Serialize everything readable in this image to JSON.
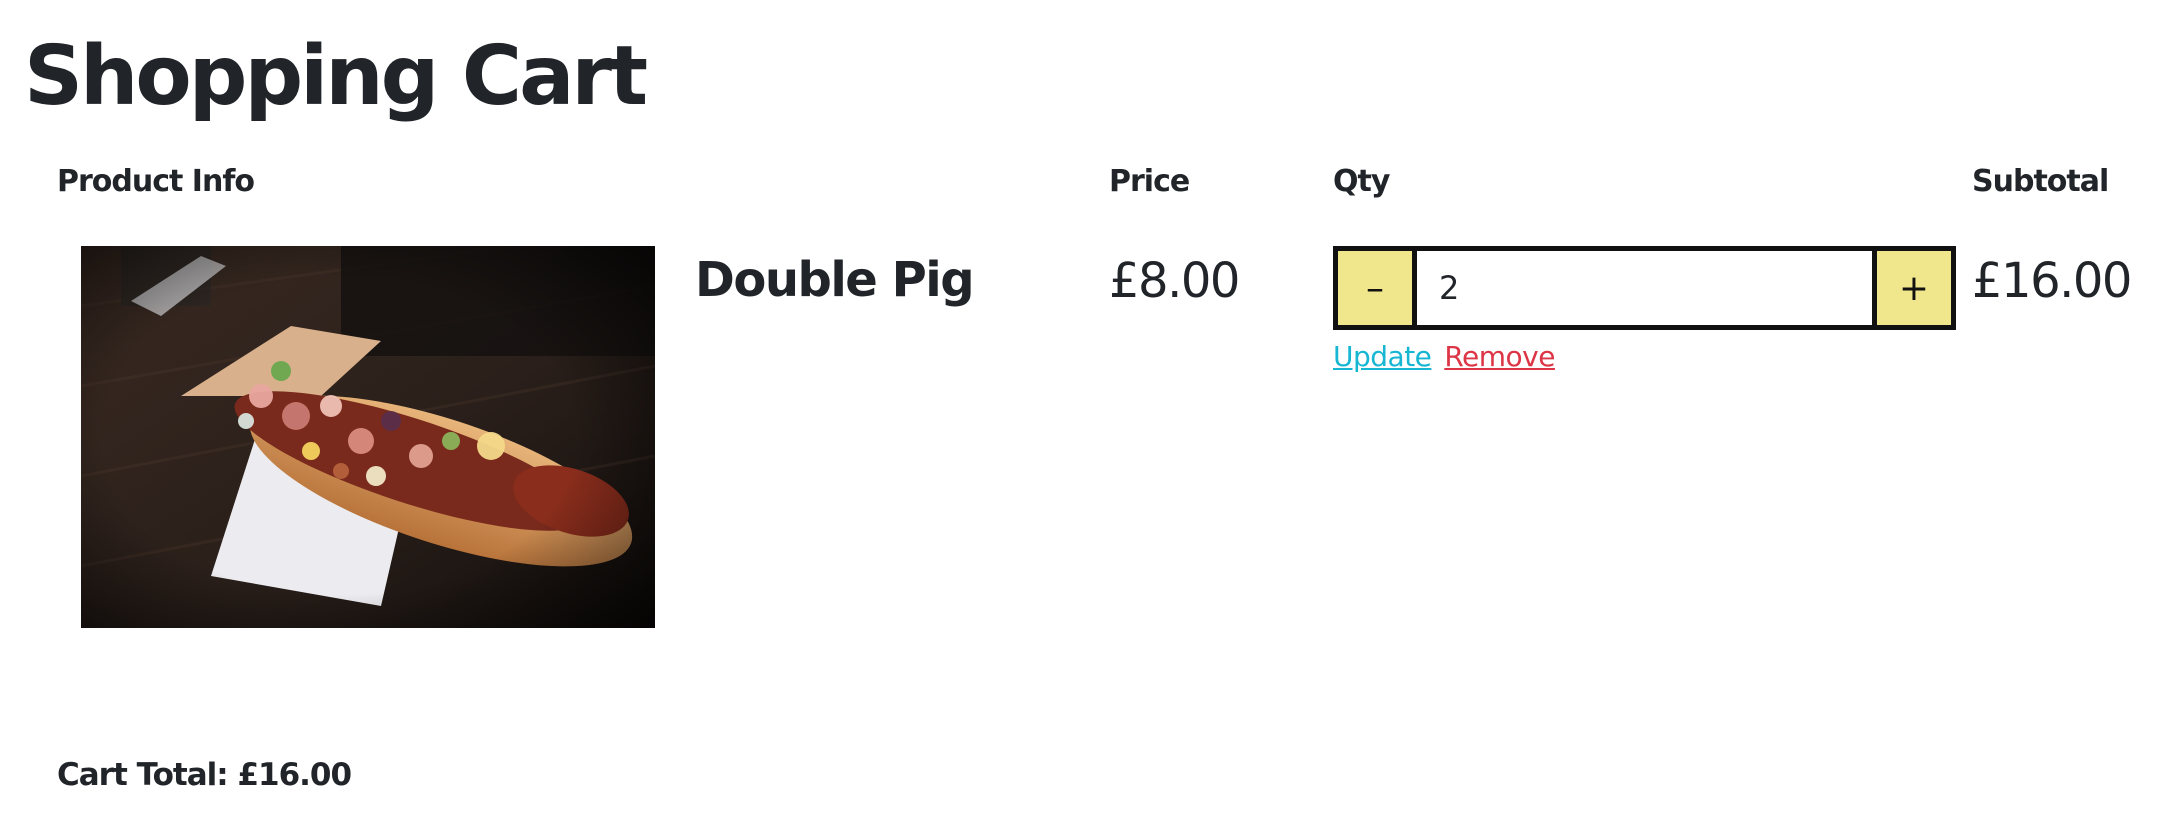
{
  "page": {
    "title": "Shopping Cart"
  },
  "table": {
    "headers": {
      "product_info": "Product Info",
      "price": "Price",
      "qty": "Qty",
      "subtotal": "Subtotal"
    },
    "rows": [
      {
        "product_name": "Double Pig",
        "image_description": "hot dog with bacon and toppings",
        "price": "£8.00",
        "qty": "2",
        "subtotal": "£16.00",
        "decrement_label": "–",
        "increment_label": "+",
        "update_label": "Update",
        "remove_label": "Remove"
      }
    ]
  },
  "summary": {
    "cart_total": "Cart Total: £16.00"
  },
  "colors": {
    "text": "#212529",
    "stepper_button": "#f0e68c",
    "stepper_border": "#111111",
    "update_link": "#17b6d3",
    "remove_link": "#dc3545"
  },
  "icons": {
    "decrement": "minus-icon",
    "increment": "plus-icon"
  }
}
